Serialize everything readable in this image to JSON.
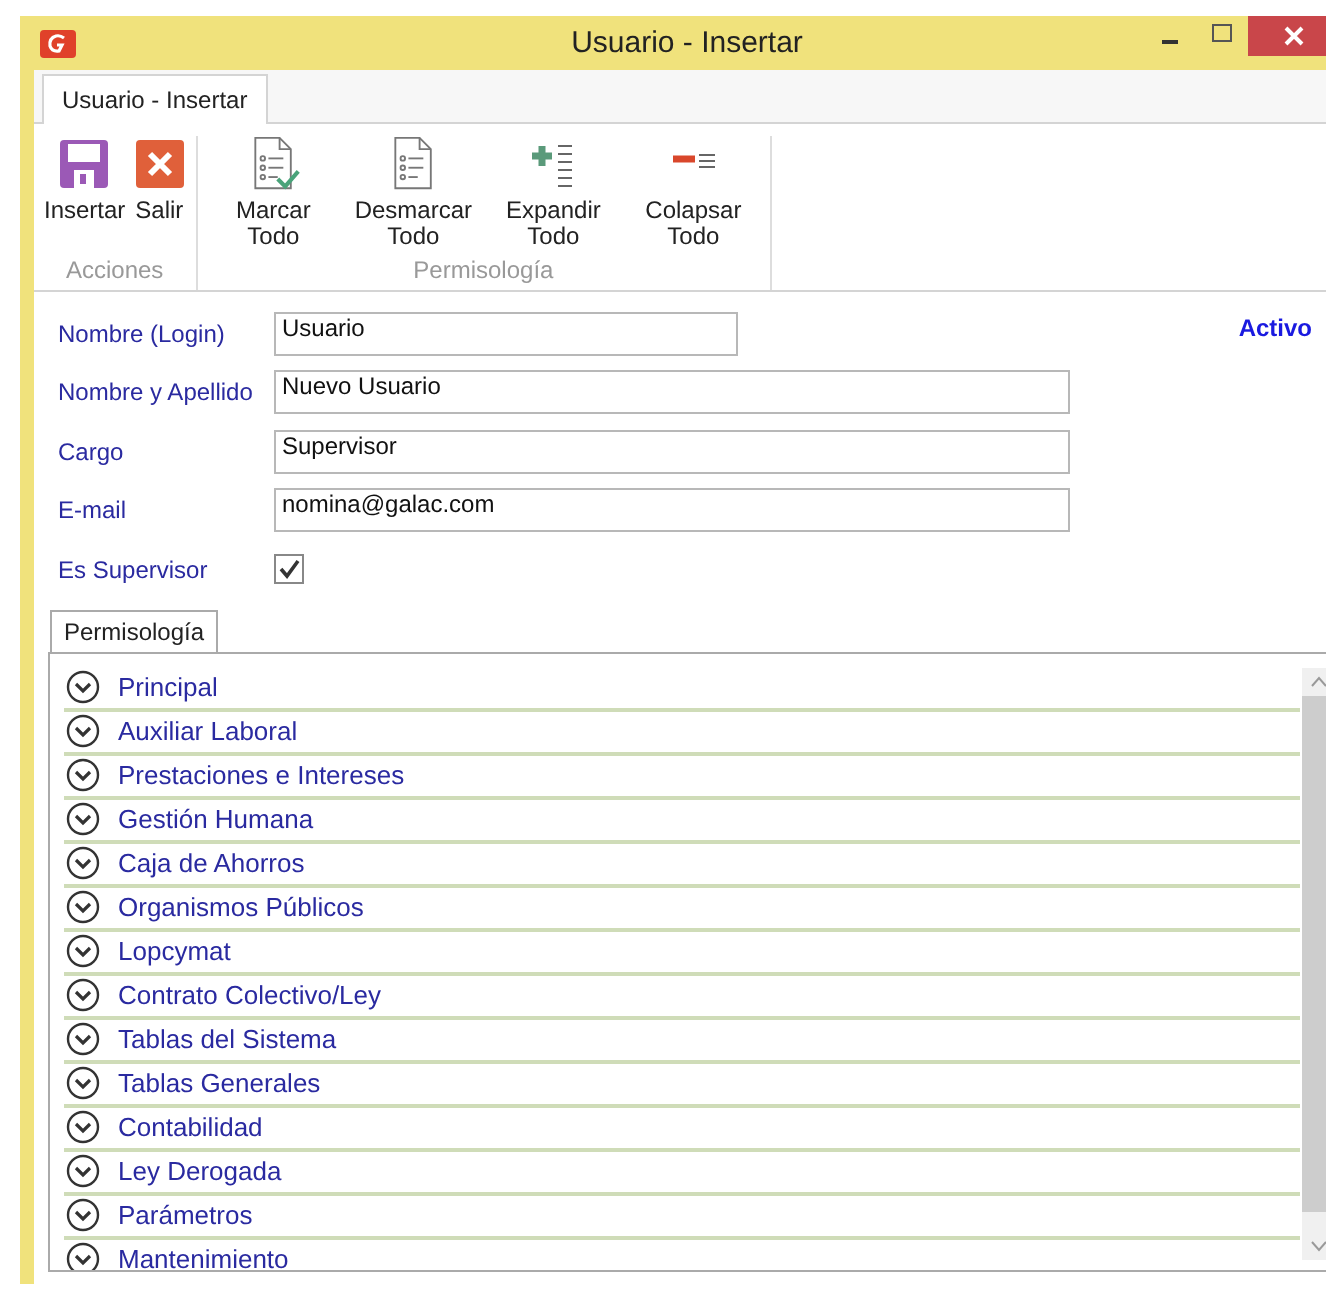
{
  "window": {
    "title": "Usuario - Insertar"
  },
  "ribbon": {
    "tabs": [
      {
        "label": "Usuario - Insertar",
        "selected": true
      }
    ],
    "groups": [
      {
        "label": "Acciones",
        "buttons": [
          {
            "label": "Insertar",
            "kind": "save"
          },
          {
            "label": "Salir",
            "kind": "exit"
          }
        ]
      },
      {
        "label": "Permisología",
        "buttons": [
          {
            "label": "Marcar Todo",
            "kind": "check-all"
          },
          {
            "label": "Desmarcar Todo",
            "kind": "uncheck-all"
          },
          {
            "label": "Expandir Todo",
            "kind": "expand"
          },
          {
            "label": "Colapsar Todo",
            "kind": "collapse"
          }
        ]
      }
    ]
  },
  "form": {
    "status": "Activo",
    "fields": [
      {
        "label": "Nombre (Login)",
        "value": "Usuario",
        "kind": "short"
      },
      {
        "label": "Nombre y Apellido",
        "value": "Nuevo Usuario",
        "kind": "long"
      },
      {
        "label": "Cargo",
        "value": "Supervisor",
        "kind": "long"
      },
      {
        "label": "E-mail",
        "value": "nomina@galac.com",
        "kind": "long"
      },
      {
        "label": "Es Supervisor",
        "kind": "checkbox",
        "checked": true
      }
    ]
  },
  "permissions": {
    "tabs": [
      {
        "label": "Permisología",
        "selected": true
      }
    ],
    "groups": [
      {
        "label": "Principal",
        "expanded": false
      },
      {
        "label": "Auxiliar Laboral",
        "expanded": false
      },
      {
        "label": "Prestaciones e Intereses",
        "expanded": false
      },
      {
        "label": "Gestión Humana",
        "expanded": false
      },
      {
        "label": "Caja de Ahorros",
        "expanded": false
      },
      {
        "label": "Organismos Públicos",
        "expanded": false
      },
      {
        "label": "Lopcymat",
        "expanded": false
      },
      {
        "label": "Contrato Colectivo/Ley",
        "expanded": false
      },
      {
        "label": "Tablas del Sistema",
        "expanded": false
      },
      {
        "label": "Tablas Generales",
        "expanded": false
      },
      {
        "label": "Contabilidad",
        "expanded": false
      },
      {
        "label": "Ley Derogada",
        "expanded": false
      },
      {
        "label": "Parámetros",
        "expanded": false
      },
      {
        "label": "Mantenimiento",
        "expanded": false
      }
    ]
  }
}
